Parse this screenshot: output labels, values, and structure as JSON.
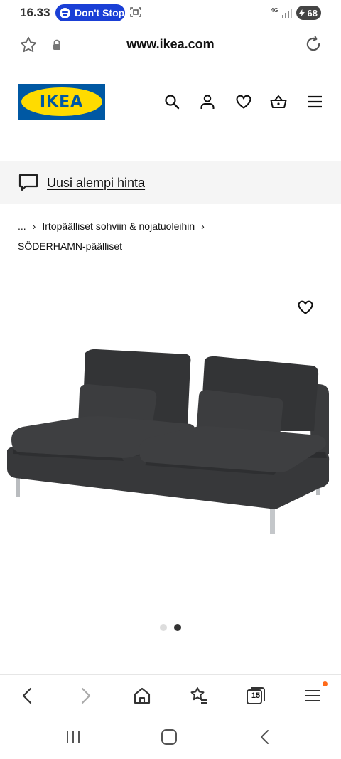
{
  "status": {
    "time": "16.33",
    "notification": "Don't Stop",
    "network": "4G",
    "battery": "68"
  },
  "browser": {
    "url": "www.ikea.com",
    "tab_count": "15"
  },
  "header": {
    "logo": "IKEA"
  },
  "promo": {
    "text": "Uusi alempi hinta"
  },
  "breadcrumb": {
    "ellipsis": "...",
    "category": "Irtopäälliset sohviin & nojatuoleihin",
    "current": "SÖDERHAMN-päälliset"
  },
  "carousel": {
    "total": 2,
    "active": 2
  },
  "colors": {
    "ikea_blue": "#0058a3",
    "ikea_yellow": "#ffdb00",
    "spotify_pill": "#1a3fd6",
    "badge": "#ff6a1a"
  }
}
